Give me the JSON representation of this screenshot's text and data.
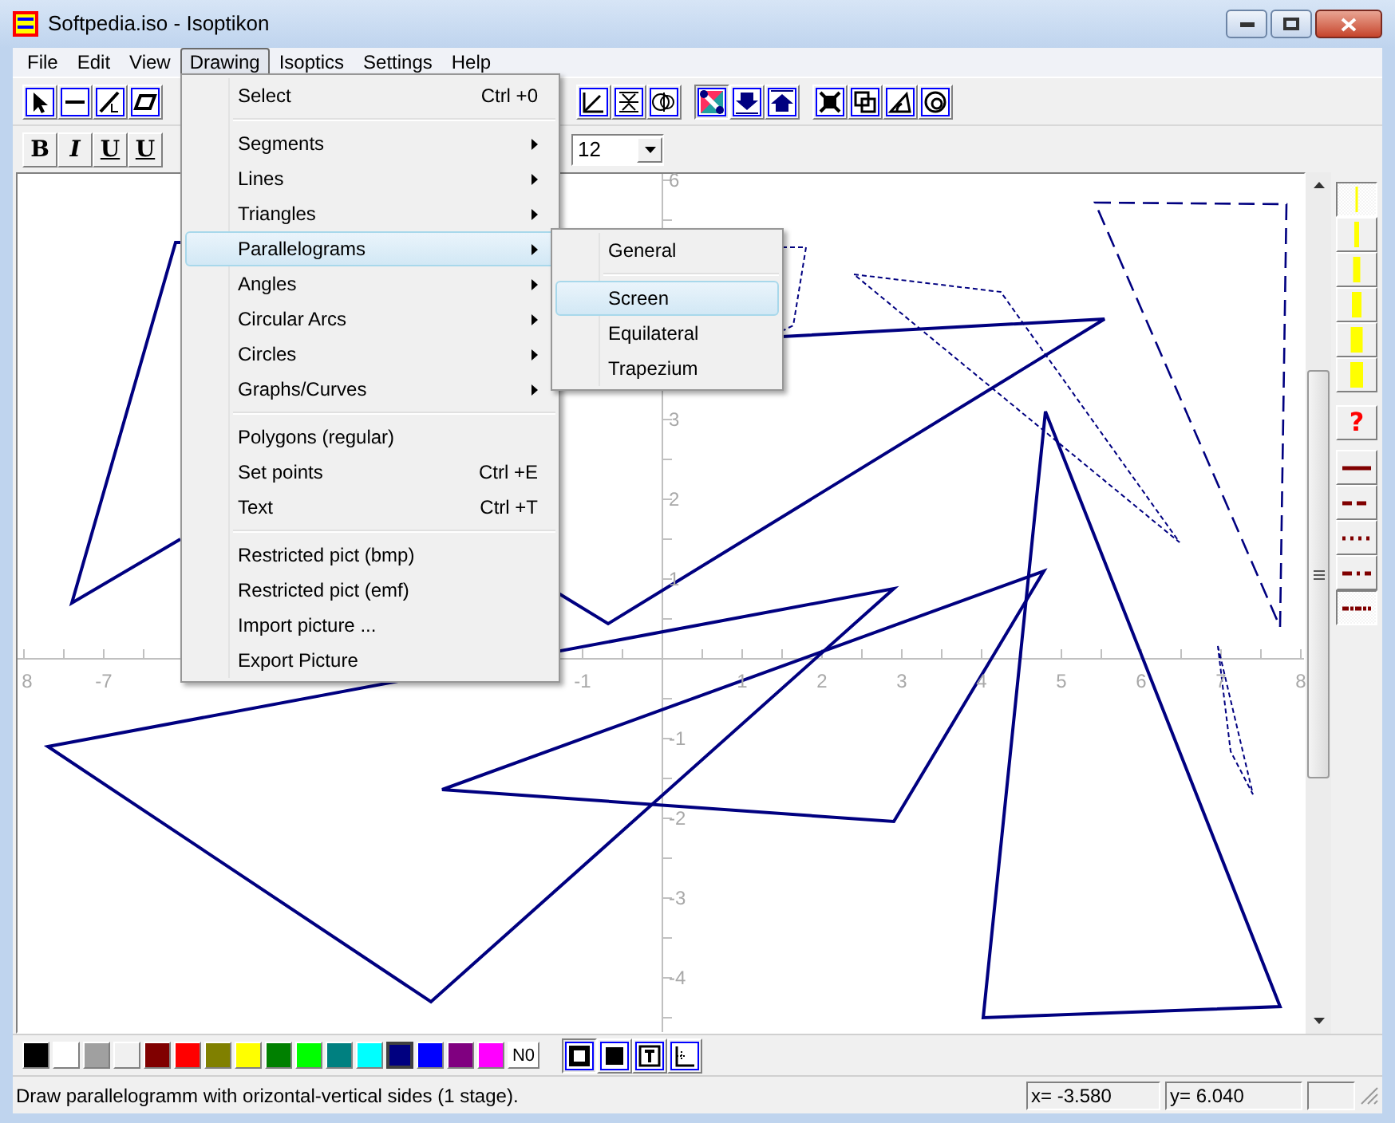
{
  "window": {
    "title": "Softpedia.iso - Isoptikon"
  },
  "menu_bar": [
    {
      "label": "File",
      "selected": false
    },
    {
      "label": "Edit",
      "selected": false
    },
    {
      "label": "View",
      "selected": false
    },
    {
      "label": "Drawing",
      "selected": true
    },
    {
      "label": "Isoptics",
      "selected": false
    },
    {
      "label": "Settings",
      "selected": false
    },
    {
      "label": "Help",
      "selected": false
    }
  ],
  "drawing_menu": [
    {
      "kind": "item",
      "label": "Select",
      "shortcut": "Ctrl +0",
      "selected": false
    },
    {
      "kind": "separator"
    },
    {
      "kind": "submenu",
      "label": "Segments",
      "selected": false
    },
    {
      "kind": "submenu",
      "label": "Lines",
      "selected": false
    },
    {
      "kind": "submenu",
      "label": "Triangles",
      "selected": false
    },
    {
      "kind": "submenu",
      "label": "Parallelograms",
      "selected": true
    },
    {
      "kind": "submenu",
      "label": "Angles",
      "selected": false
    },
    {
      "kind": "submenu",
      "label": "Circular Arcs",
      "selected": false
    },
    {
      "kind": "submenu",
      "label": "Circles",
      "selected": false
    },
    {
      "kind": "submenu",
      "label": "Graphs/Curves",
      "selected": false
    },
    {
      "kind": "separator"
    },
    {
      "kind": "item",
      "label": "Polygons (regular)",
      "selected": false
    },
    {
      "kind": "item",
      "label": "Set points",
      "shortcut": "Ctrl +E",
      "selected": false
    },
    {
      "kind": "item",
      "label": "Text",
      "shortcut": "Ctrl +T",
      "selected": false
    },
    {
      "kind": "separator"
    },
    {
      "kind": "item",
      "label": "Restricted pict (bmp)",
      "selected": false
    },
    {
      "kind": "item",
      "label": "Restricted pict (emf)",
      "selected": false
    },
    {
      "kind": "item",
      "label": "Import picture ...",
      "selected": false
    },
    {
      "kind": "item",
      "label": "Export Picture",
      "selected": false
    }
  ],
  "parallelograms_submenu": [
    {
      "kind": "item",
      "label": "General",
      "selected": false
    },
    {
      "kind": "separator"
    },
    {
      "kind": "item",
      "label": "Screen",
      "selected": true
    },
    {
      "kind": "item",
      "label": "Equilateral",
      "selected": false
    },
    {
      "kind": "item",
      "label": "Trapezium",
      "selected": false
    }
  ],
  "toolbar": [
    {
      "selected": false
    },
    {
      "selected": false
    },
    {
      "selected": false
    },
    {
      "selected": false
    },
    {
      "selected": false
    },
    {
      "selected": false
    },
    {
      "selected": false
    },
    {
      "selected": true
    },
    {
      "selected": false
    },
    {
      "selected": false
    },
    {
      "selected": false
    },
    {
      "selected": false
    },
    {
      "selected": false
    },
    {
      "selected": false
    }
  ],
  "format_bar": {
    "buttons": [
      {
        "kind": "bold",
        "label": "B",
        "selected": false
      },
      {
        "kind": "italic",
        "label": "I",
        "selected": false
      },
      {
        "kind": "underline",
        "label": "U",
        "selected": false
      },
      {
        "kind": "strike",
        "label": "U",
        "selected": false
      }
    ],
    "font_size": "12"
  },
  "canvas": {
    "x_labels": [
      "8",
      "-7",
      "-1",
      "1",
      "2",
      "3",
      "4",
      "5",
      "6",
      "7",
      "8"
    ],
    "y_labels": [
      "6",
      "3",
      "2",
      "1",
      "-1",
      "-2",
      "-3",
      "-4"
    ]
  },
  "line_palette": [
    {
      "kind": "thickness",
      "selected": true
    },
    {
      "kind": "thickness",
      "selected": false
    },
    {
      "kind": "thickness",
      "selected": false
    },
    {
      "kind": "thickness",
      "selected": false
    },
    {
      "kind": "thickness",
      "selected": false
    },
    {
      "kind": "thickness",
      "selected": false
    },
    {
      "kind": "help",
      "label": "?"
    },
    {
      "kind": "dash",
      "selected": false
    },
    {
      "kind": "dash",
      "selected": false
    },
    {
      "kind": "dash",
      "selected": false
    },
    {
      "kind": "dash",
      "selected": false
    },
    {
      "kind": "dash",
      "selected": true
    }
  ],
  "colors": [
    {
      "kind": "swatch",
      "color": "#000000",
      "selected": false
    },
    {
      "kind": "swatch",
      "color": "#ffffff",
      "selected": false
    },
    {
      "kind": "swatch",
      "color": "#a0a0a0",
      "selected": false
    },
    {
      "kind": "swatch",
      "color": "#f0f0f0",
      "selected": false
    },
    {
      "kind": "swatch",
      "color": "#800000",
      "selected": false
    },
    {
      "kind": "swatch",
      "color": "#ff0000",
      "selected": false
    },
    {
      "kind": "swatch",
      "color": "#808000",
      "selected": false
    },
    {
      "kind": "swatch",
      "color": "#ffff00",
      "selected": false
    },
    {
      "kind": "swatch",
      "color": "#008000",
      "selected": false
    },
    {
      "kind": "swatch",
      "color": "#00ff00",
      "selected": false
    },
    {
      "kind": "swatch",
      "color": "#008080",
      "selected": false
    },
    {
      "kind": "swatch",
      "color": "#00ffff",
      "selected": false
    },
    {
      "kind": "swatch",
      "color": "#000080",
      "selected": true
    },
    {
      "kind": "swatch",
      "color": "#0000ff",
      "selected": false
    },
    {
      "kind": "swatch",
      "color": "#800080",
      "selected": false
    },
    {
      "kind": "swatch",
      "color": "#ff00ff",
      "selected": false
    },
    {
      "kind": "none",
      "label": "N0",
      "selected": false
    }
  ],
  "fill_modes": [
    {
      "selected": true
    },
    {
      "selected": false
    },
    {
      "selected": false
    },
    {
      "selected": false
    }
  ],
  "status_bar": {
    "message": "Draw parallelogramm with orizontal-vertical sides (1 stage).",
    "x": "x= -3.580",
    "y": "y= 6.040"
  }
}
